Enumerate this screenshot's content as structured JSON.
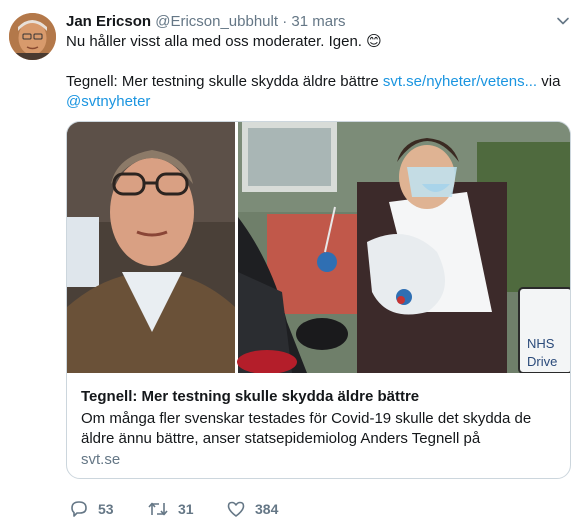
{
  "tweet": {
    "author_name": "Jan Ericson",
    "handle": "@Ericson_ubbhult",
    "separator": "·",
    "date": "31 mars",
    "line1": "Nu håller visst alla med oss moderater. Igen. 😊",
    "line2_text": "Tegnell: Mer testning skulle skydda äldre bättre ",
    "line2_link": "svt.se/nyheter/vetens...",
    "line2_via": " via",
    "line3_mention": "@svtnyheter"
  },
  "card": {
    "title": "Tegnell: Mer testning skulle skydda äldre bättre",
    "description": "Om många fler svenskar testades för Covid-19 skulle det skydda de äldre ännu bättre, anser statsepidemiolog Anders Tegnell på",
    "domain": "svt.se",
    "sign_text_1": "NHS",
    "sign_text_2": "Drive"
  },
  "actions": {
    "replies": "53",
    "retweets": "31",
    "likes": "384",
    "reply_icon": "reply-icon",
    "retweet_icon": "retweet-icon",
    "like_icon": "like-icon"
  },
  "colors": {
    "link": "#1b95e0",
    "muted": "#657786",
    "border": "#ccd6dd"
  }
}
